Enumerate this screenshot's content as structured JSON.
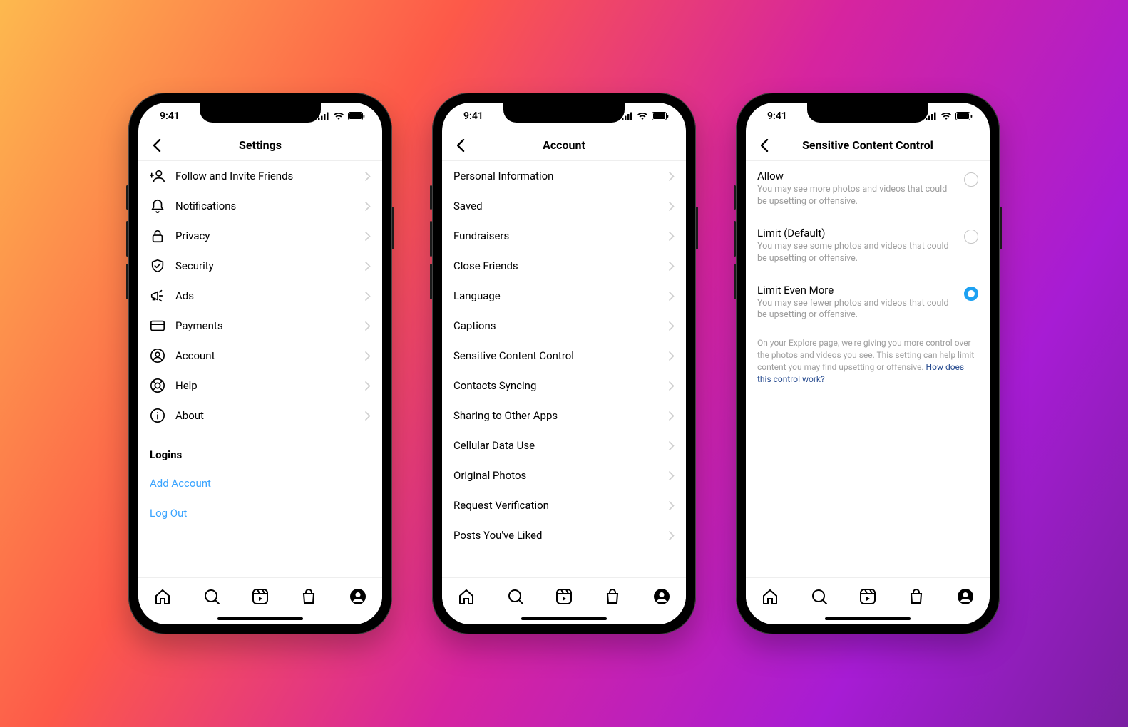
{
  "status_time": "9:41",
  "phones": [
    {
      "id": "settings",
      "title": "Settings",
      "rows": [
        {
          "icon": "invite",
          "label": "Follow and Invite Friends"
        },
        {
          "icon": "bell",
          "label": "Notifications"
        },
        {
          "icon": "lock",
          "label": "Privacy"
        },
        {
          "icon": "shield",
          "label": "Security"
        },
        {
          "icon": "megaphone",
          "label": "Ads"
        },
        {
          "icon": "card",
          "label": "Payments"
        },
        {
          "icon": "person",
          "label": "Account"
        },
        {
          "icon": "life-ring",
          "label": "Help"
        },
        {
          "icon": "info",
          "label": "About"
        }
      ],
      "logins_header": "Logins",
      "links": [
        {
          "label": "Add Account"
        },
        {
          "label": "Log Out"
        }
      ]
    },
    {
      "id": "account",
      "title": "Account",
      "rows": [
        {
          "label": "Personal Information"
        },
        {
          "label": "Saved"
        },
        {
          "label": "Fundraisers"
        },
        {
          "label": "Close Friends"
        },
        {
          "label": "Language"
        },
        {
          "label": "Captions"
        },
        {
          "label": "Sensitive Content Control"
        },
        {
          "label": "Contacts Syncing"
        },
        {
          "label": "Sharing to Other Apps"
        },
        {
          "label": "Cellular Data Use"
        },
        {
          "label": "Original Photos"
        },
        {
          "label": "Request Verification"
        },
        {
          "label": "Posts You've Liked"
        }
      ]
    },
    {
      "id": "scc",
      "title": "Sensitive Content Control",
      "options": [
        {
          "title": "Allow",
          "sub": "You may see more photos and videos that could be upsetting or offensive.",
          "selected": false
        },
        {
          "title": "Limit (Default)",
          "sub": "You may see some photos and videos that could be upsetting or offensive.",
          "selected": false
        },
        {
          "title": "Limit Even More",
          "sub": "You may see fewer photos and videos that could be upsetting or offensive.",
          "selected": true
        }
      ],
      "footer": "On your Explore page, we're giving you more control over the photos and videos you see. This setting can help limit content you may find upsetting or offensive.",
      "footer_link": "How does this control work?"
    }
  ],
  "tabbar_icons": [
    "home",
    "search",
    "reels",
    "shop",
    "profile"
  ]
}
